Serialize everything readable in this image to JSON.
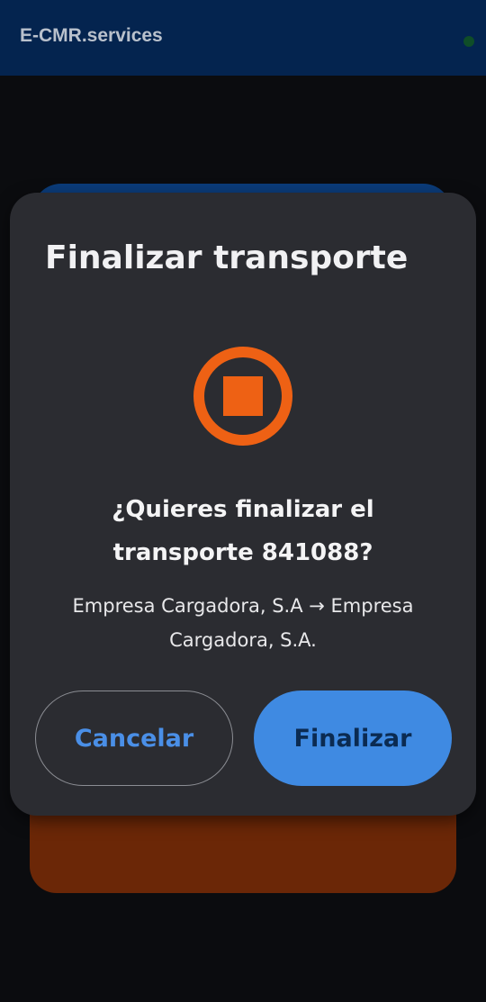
{
  "app": {
    "title": "E-CMR.services"
  },
  "dialog": {
    "title": "Finalizar transporte",
    "icon": "stop-circle-icon",
    "question_line1": "¿Quieres finalizar el",
    "question_line2": "transporte 841088?",
    "route_line1": "Empresa Cargadora, S.A → Empresa",
    "route_line2": "Cargadora, S.A.",
    "cancel_label": "Cancelar",
    "finalize_label": "Finalizar"
  },
  "colors": {
    "appbar": "#04244f",
    "dialog_bg": "#2b2c31",
    "accent_orange": "#ee6114",
    "primary_blue": "#3f8ae2",
    "brown_card": "#6b2707"
  }
}
